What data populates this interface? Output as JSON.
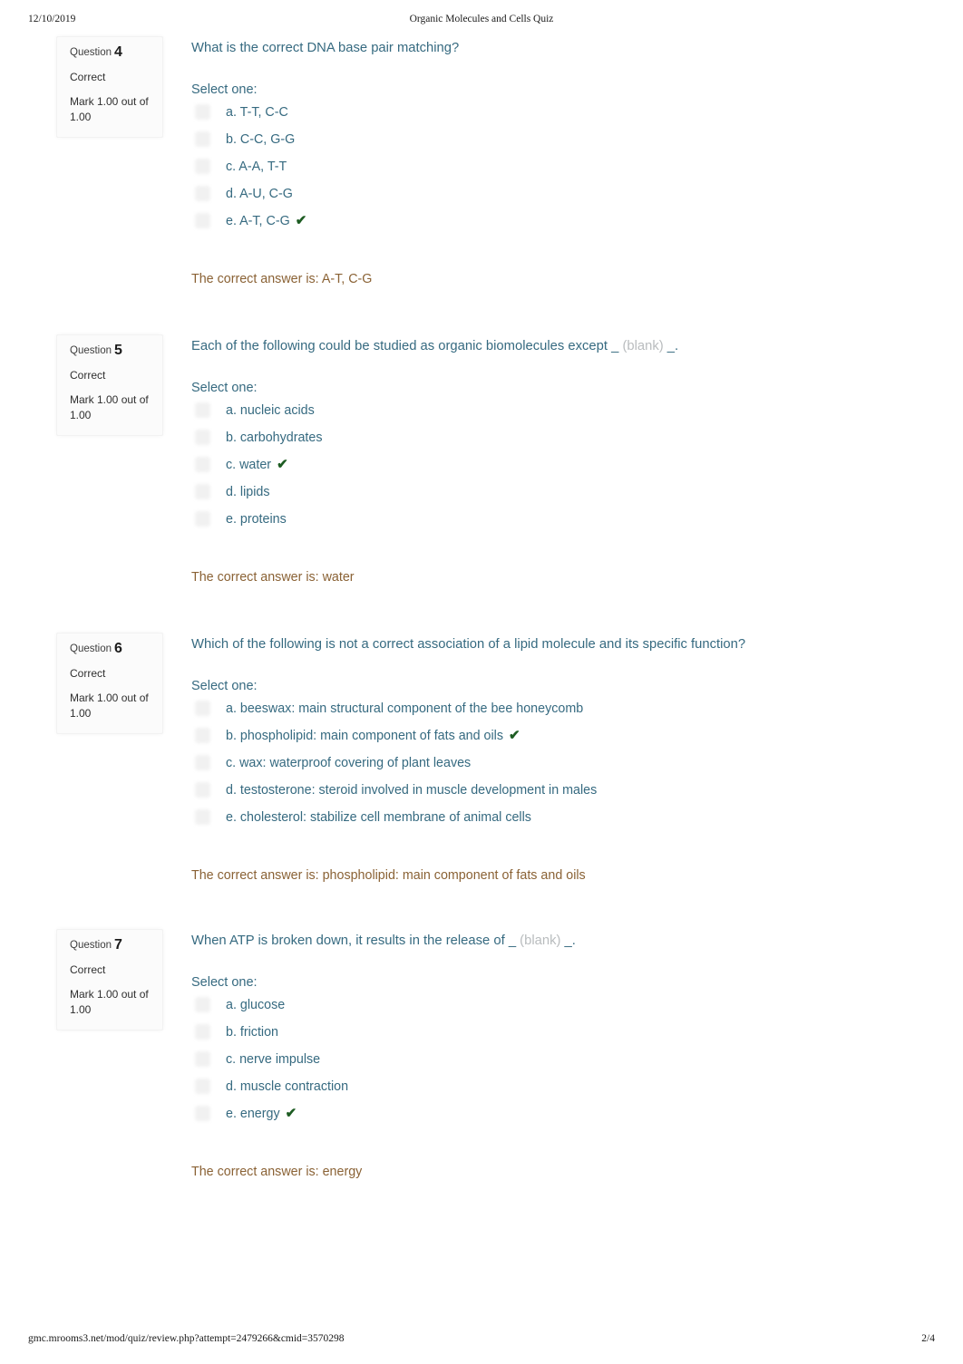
{
  "print_header": {
    "date": "12/10/2019",
    "title": "Organic Molecules and Cells Quiz"
  },
  "print_footer": {
    "url": "gmc.mrooms3.net/mod/quiz/review.php?attempt=2479266&cmid=3570298",
    "page": "2/4"
  },
  "labels": {
    "question_label": "Question",
    "select_one": "Select one:",
    "tick": "✔"
  },
  "colors": {
    "question_text": "#366a80",
    "answer_text": "#366a80",
    "correct_answer_text": "#8a6235",
    "tick_green": "#1d5c22",
    "blank_gray": "#b9bcbe",
    "info_box_bg": "#fbfbfb"
  },
  "questions": [
    {
      "number": "4",
      "state": "Correct",
      "grade": "Mark 1.00 out of 1.00",
      "text_before": "What is the correct DNA base pair matching?",
      "blank": "",
      "text_after": "",
      "prompt": "Select one:",
      "options": [
        {
          "label": "a. T-T, C-C",
          "correct": false
        },
        {
          "label": "b. C-C, G-G",
          "correct": false
        },
        {
          "label": "c. A-A, T-T",
          "correct": false
        },
        {
          "label": "d. A-U, C-G",
          "correct": false
        },
        {
          "label": "e. A-T, C-G",
          "correct": true
        }
      ],
      "correct_answer": "The correct answer is: A-T, C-G"
    },
    {
      "number": "5",
      "state": "Correct",
      "grade": "Mark 1.00 out of 1.00",
      "text_before": "Each of the following could be studied as organic biomolecules except _ ",
      "blank": "(blank)",
      "text_after": " _.",
      "prompt": "Select one:",
      "options": [
        {
          "label": "a. nucleic acids",
          "correct": false
        },
        {
          "label": "b. carbohydrates",
          "correct": false
        },
        {
          "label": "c. water",
          "correct": true
        },
        {
          "label": "d. lipids",
          "correct": false
        },
        {
          "label": "e. proteins",
          "correct": false
        }
      ],
      "correct_answer": "The correct answer is: water"
    },
    {
      "number": "6",
      "state": "Correct",
      "grade": "Mark 1.00 out of 1.00",
      "text_before": "Which of the following is not a correct association of a lipid molecule and its specific function?",
      "blank": "",
      "text_after": "",
      "prompt": "Select one:",
      "options": [
        {
          "label": "a. beeswax: main structural component of the bee honeycomb",
          "correct": false
        },
        {
          "label": "b. phospholipid: main component of fats and oils",
          "correct": true
        },
        {
          "label": "c. wax: waterproof covering of plant leaves",
          "correct": false
        },
        {
          "label": "d. testosterone: steroid involved in muscle development in males",
          "correct": false
        },
        {
          "label": "e. cholesterol: stabilize cell membrane of animal cells",
          "correct": false
        }
      ],
      "correct_answer": "The correct answer is: phospholipid: main component of fats and oils"
    },
    {
      "number": "7",
      "state": "Correct",
      "grade": "Mark 1.00 out of 1.00",
      "text_before": "When ATP is broken down, it results in the release of _ ",
      "blank": "(blank)",
      "text_after": " _.",
      "prompt": "Select one:",
      "options": [
        {
          "label": "a. glucose",
          "correct": false
        },
        {
          "label": "b. friction",
          "correct": false
        },
        {
          "label": "c. nerve impulse",
          "correct": false
        },
        {
          "label": "d. muscle contraction",
          "correct": false
        },
        {
          "label": "e. energy",
          "correct": true
        }
      ],
      "correct_answer": "The correct answer is: energy"
    }
  ]
}
